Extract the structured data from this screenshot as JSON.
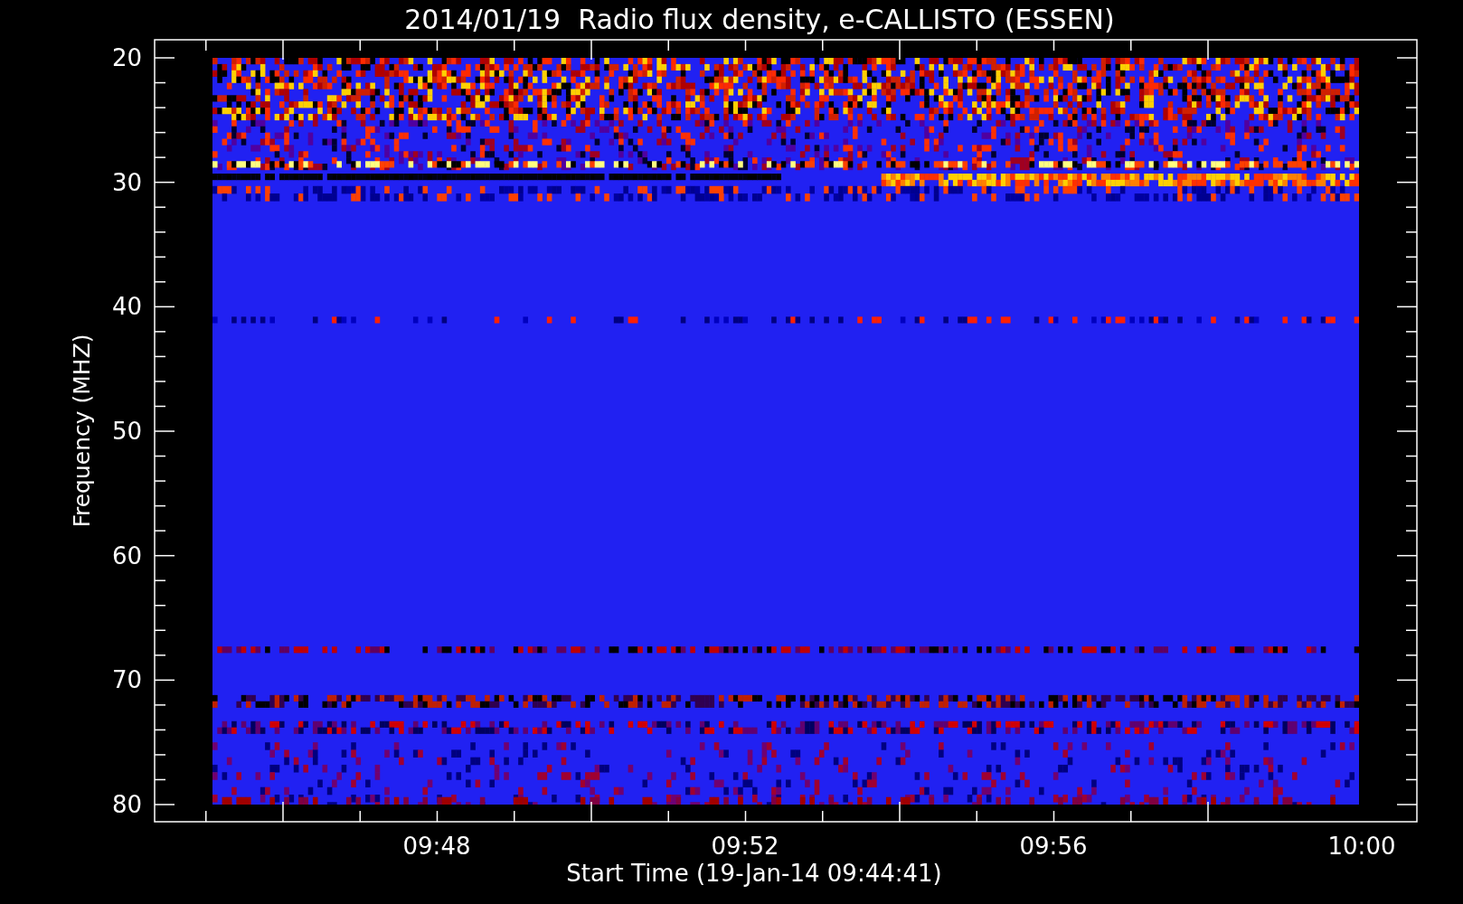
{
  "title": "2014/01/19  Radio flux density, e-CALLISTO (ESSEN)",
  "y_axis": {
    "label": "Frequency (MHZ)",
    "ticks": [
      "20",
      "30",
      "40",
      "50",
      "60",
      "70",
      "80"
    ]
  },
  "x_axis": {
    "label": "Start Time (19-Jan-14 09:44:41)",
    "ticks": [
      "09:48",
      "09:52",
      "09:56",
      "10:00"
    ]
  }
}
